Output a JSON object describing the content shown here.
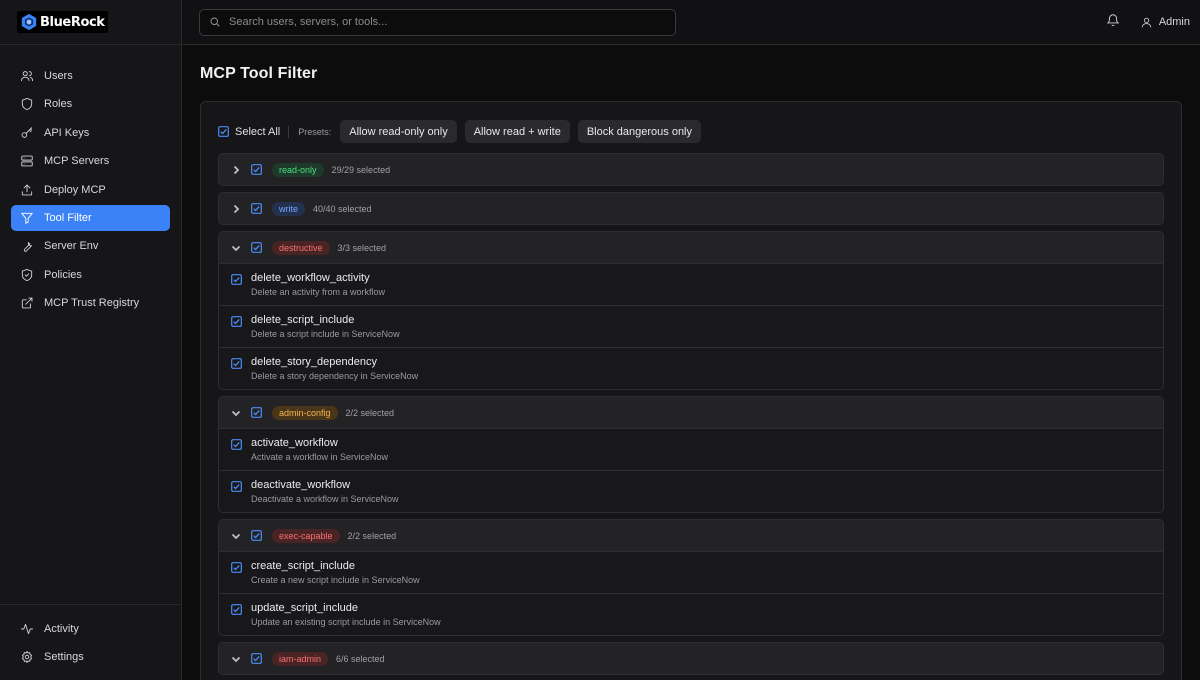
{
  "brand": {
    "name": "BlueRock"
  },
  "sidebar": {
    "items": [
      {
        "label": "Users",
        "icon": "users-icon"
      },
      {
        "label": "Roles",
        "icon": "shield-icon"
      },
      {
        "label": "API Keys",
        "icon": "key-icon"
      },
      {
        "label": "MCP Servers",
        "icon": "server-icon"
      },
      {
        "label": "Deploy MCP",
        "icon": "upload-icon"
      },
      {
        "label": "Tool Filter",
        "icon": "filter-icon",
        "active": true
      },
      {
        "label": "Server Env",
        "icon": "wrench-icon"
      },
      {
        "label": "Policies",
        "icon": "shield-check-icon"
      },
      {
        "label": "MCP Trust Registry",
        "icon": "external-link-icon"
      }
    ],
    "bottom": [
      {
        "label": "Activity",
        "icon": "activity-icon"
      },
      {
        "label": "Settings",
        "icon": "gear-icon"
      }
    ]
  },
  "header": {
    "search_placeholder": "Search users, servers, or tools...",
    "user_label": "Admin"
  },
  "page": {
    "title": "MCP Tool Filter",
    "select_all_label": "Select All",
    "presets_label": "Presets:",
    "presets": [
      "Allow read-only only",
      "Allow read + write",
      "Block dangerous only"
    ]
  },
  "groups": [
    {
      "tag": "read-only",
      "count": "29/29 selected",
      "expanded": false,
      "color": "#4ade80",
      "bg": "#1e3a2a",
      "tools": []
    },
    {
      "tag": "write",
      "count": "40/40 selected",
      "expanded": false,
      "color": "#7aa7ff",
      "bg": "#23314f",
      "tools": []
    },
    {
      "tag": "destructive",
      "count": "3/3 selected",
      "expanded": true,
      "color": "#f87171",
      "bg": "#4a2424",
      "tools": [
        {
          "name": "delete_workflow_activity",
          "desc": "Delete an activity from a workflow"
        },
        {
          "name": "delete_script_include",
          "desc": "Delete a script include in ServiceNow"
        },
        {
          "name": "delete_story_dependency",
          "desc": "Delete a story dependency in ServiceNow"
        }
      ]
    },
    {
      "tag": "admin-config",
      "count": "2/2 selected",
      "expanded": true,
      "color": "#f5b452",
      "bg": "#4a3518",
      "tools": [
        {
          "name": "activate_workflow",
          "desc": "Activate a workflow in ServiceNow"
        },
        {
          "name": "deactivate_workflow",
          "desc": "Deactivate a workflow in ServiceNow"
        }
      ]
    },
    {
      "tag": "exec-capable",
      "count": "2/2 selected",
      "expanded": true,
      "color": "#f87171",
      "bg": "#4a2424",
      "tools": [
        {
          "name": "create_script_include",
          "desc": "Create a new script include in ServiceNow"
        },
        {
          "name": "update_script_include",
          "desc": "Update an existing script include in ServiceNow"
        }
      ]
    },
    {
      "tag": "iam-admin",
      "count": "6/6 selected",
      "expanded": true,
      "color": "#f87171",
      "bg": "#4a2424",
      "tools": []
    }
  ],
  "colors": {
    "accent": "#3b82f6"
  }
}
